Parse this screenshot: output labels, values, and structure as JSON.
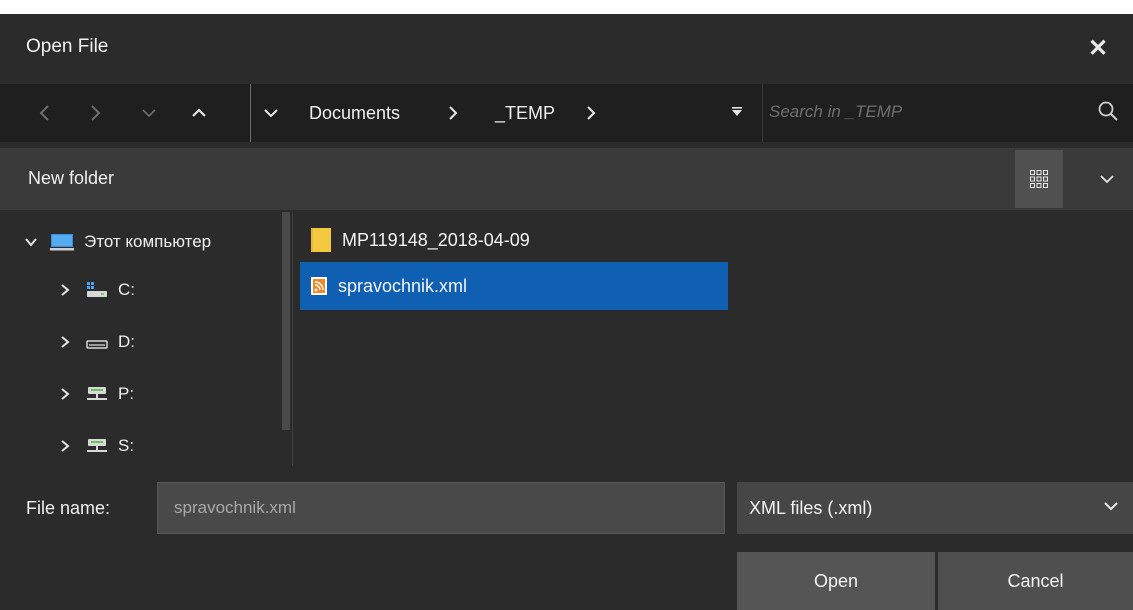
{
  "window": {
    "title": "Open File"
  },
  "nav": {
    "breadcrumbs": [
      "Documents",
      "_TEMP"
    ],
    "search_placeholder": "Search in _TEMP"
  },
  "toolbar": {
    "new_folder_label": "New folder"
  },
  "tree": {
    "items": [
      {
        "label": "Этот компьютер",
        "icon": "computer-icon",
        "expanded": true
      },
      {
        "label": "C:",
        "icon": "system-drive-icon"
      },
      {
        "label": "D:",
        "icon": "drive-icon"
      },
      {
        "label": "P:",
        "icon": "network-drive-icon"
      },
      {
        "label": "S:",
        "icon": "network-drive-icon"
      }
    ]
  },
  "files": [
    {
      "name": "MP119148_2018-04-09",
      "icon": "folder-icon",
      "selected": false
    },
    {
      "name": "spravochnik.xml",
      "icon": "xml-file-icon",
      "selected": true
    }
  ],
  "bottom": {
    "file_name_label": "File name:",
    "file_name_value": "spravochnik.xml",
    "file_type": "XML files (.xml)",
    "open_label": "Open",
    "cancel_label": "Cancel"
  },
  "colors": {
    "background": "#2b2b2b",
    "nav_background": "#1f1f1f",
    "toolbar": "#3a3a3a",
    "selection": "#0f5fb3"
  }
}
